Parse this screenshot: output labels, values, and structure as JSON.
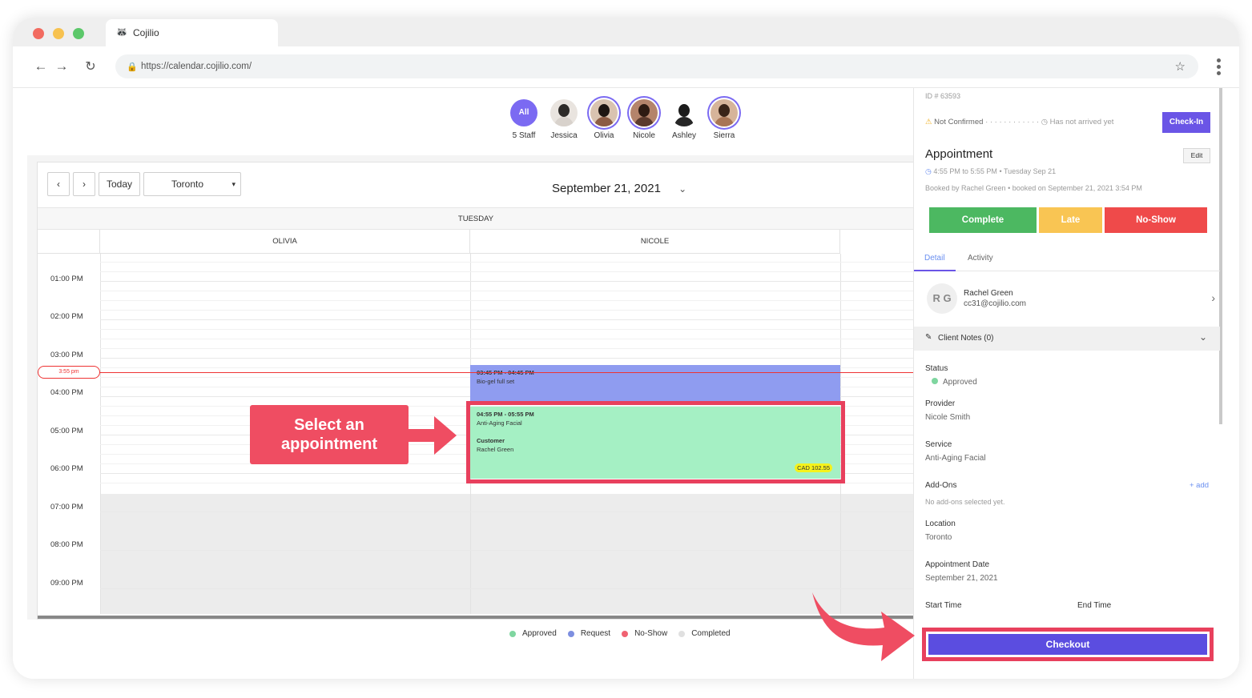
{
  "browser": {
    "tab_title": "Cojilio",
    "url": "https://calendar.cojilio.com/"
  },
  "staff": [
    {
      "label": "5 Staff",
      "avatar_text": "All"
    },
    {
      "label": "Jessica"
    },
    {
      "label": "Olivia"
    },
    {
      "label": "Nicole"
    },
    {
      "label": "Ashley"
    },
    {
      "label": "Sierra"
    }
  ],
  "calendar": {
    "today_label": "Today",
    "location_select": "Toronto",
    "date": "September 21, 2021",
    "day": "TUESDAY",
    "columns": [
      "OLIVIA",
      "NICOLE"
    ],
    "times": [
      "01:00 PM",
      "02:00 PM",
      "03:00 PM",
      "04:00 PM",
      "05:00 PM",
      "06:00 PM",
      "07:00 PM",
      "08:00 PM",
      "09:00 PM"
    ],
    "now_label": "3:55 pm",
    "appointments": [
      {
        "time": "03:45 PM - 04:45 PM",
        "service": "Bio-gel full set",
        "color": "#8f9cf0"
      },
      {
        "time": "04:55 PM - 05:55 PM",
        "service": "Anti-Aging Facial",
        "customer_label": "Customer",
        "customer": "Rachel Green",
        "price": "CAD 102.55",
        "color": "#a5f0c4"
      }
    ]
  },
  "callout": {
    "line1": "Select an",
    "line2": "appointment"
  },
  "legend": [
    {
      "label": "Approved",
      "color": "#7fd6a0"
    },
    {
      "label": "Request",
      "color": "#7d8fe0"
    },
    {
      "label": "No-Show",
      "color": "#f06272"
    },
    {
      "label": "Completed",
      "color": "#e0e0e0"
    }
  ],
  "details": {
    "id": "ID # 63593",
    "confirm_status": "Not Confirmed",
    "arrival_status": "Has not arrived yet",
    "checkin_label": "Check-In",
    "title": "Appointment",
    "edit_label": "Edit",
    "time_range": "4:55 PM to 5:55 PM",
    "date_short": "Tuesday Sep 21",
    "booked_by": "Booked by Rachel Green",
    "booked_on": "booked on September 21, 2021 3:54 PM",
    "actions": {
      "complete": "Complete",
      "late": "Late",
      "noshow": "No-Show"
    },
    "tabs": [
      "Detail",
      "Activity"
    ],
    "client": {
      "initials": "R G",
      "name": "Rachel Green",
      "email": "cc31@cojilio.com"
    },
    "notes_label": "Client Notes (0)",
    "fields": {
      "status_label": "Status",
      "status_value": "Approved",
      "provider_label": "Provider",
      "provider_value": "Nicole Smith",
      "service_label": "Service",
      "service_value": "Anti-Aging Facial",
      "addons_label": "Add-Ons",
      "addons_add": "+ add",
      "addons_value": "No add-ons selected yet.",
      "location_label": "Location",
      "location_value": "Toronto",
      "apptdate_label": "Appointment Date",
      "apptdate_value": "September 21, 2021",
      "start_label": "Start Time",
      "end_label": "End Time"
    },
    "checkout_label": "Checkout"
  },
  "colors": {
    "accent": "#7b6af2",
    "highlight": "#e8405d",
    "complete": "#4cb861",
    "late": "#f9c553",
    "noshow": "#ef4a4a",
    "checkout": "#5b4de0"
  }
}
